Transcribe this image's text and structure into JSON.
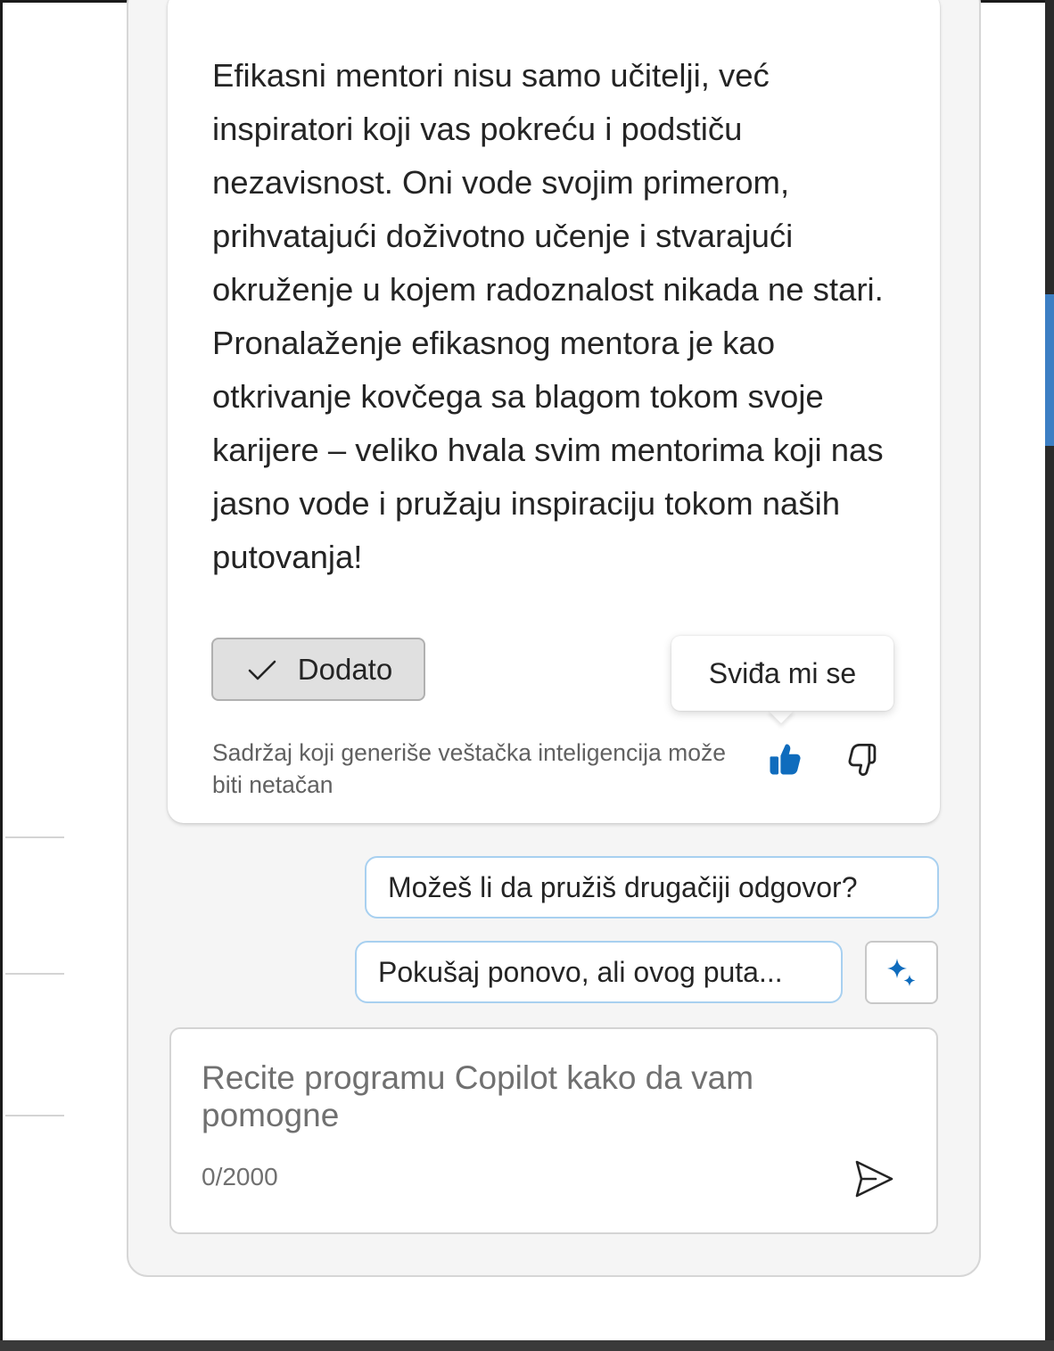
{
  "response": {
    "text": "Efikasni mentori nisu samo učitelji, već inspiratori koji vas pokreću i podstiču nezavisnost. Oni vode svojim primerom, prihvatajući doživotno učenje i stvarajući okruženje u kojem radoznalost nikada ne stari. Pronalaženje efikasnog mentora je kao otkrivanje kovčega sa blagom tokom svoje karijere – veliko hvala svim mentorima koji nas jasno vode i pružaju inspiraciju tokom naših putovanja!",
    "added_button_label": "Dodato",
    "added_icon": "checkmark-icon",
    "disclaimer": "Sadržaj koji generiše veštačka inteligencija može biti netačan",
    "like_tooltip": "Sviđa mi se",
    "like_icon": "thumbs-up-filled-icon",
    "dislike_icon": "thumbs-down-icon",
    "accent_color": "#0f6cbd"
  },
  "suggestions": [
    {
      "label": "Možeš li da pružiš drugačiji odgovor?"
    },
    {
      "label": "Pokušaj ponovo, ali ovog puta..."
    }
  ],
  "sparkle_icon": "sparkle-icon",
  "composer": {
    "placeholder": "Recite programu Copilot kako da vam pomogne",
    "counter": "0/2000",
    "send_icon": "send-icon"
  }
}
